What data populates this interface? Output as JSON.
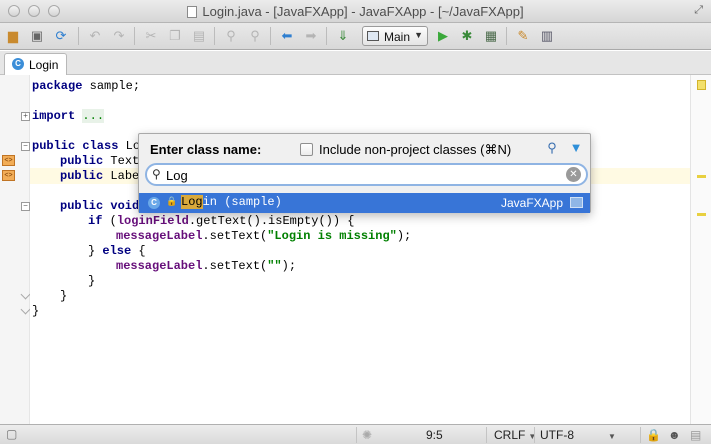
{
  "window": {
    "title": "Login.java - [JavaFXApp] - JavaFXApp - [~/JavaFXApp]"
  },
  "toolbar": {
    "run_config": "Main"
  },
  "tabs": [
    {
      "label": "Login",
      "badge": "C"
    }
  ],
  "code": {
    "l1": {
      "kw": "package",
      "rest": " sample;"
    },
    "l3": {
      "kw": "import",
      "fold": "..."
    },
    "l5": {
      "kw": "public class",
      "rest": " Lo"
    },
    "l6": {
      "kw": "public",
      "rest": " Text"
    },
    "l7": {
      "kw": "public",
      "rest": " Labe"
    },
    "l9": {
      "kw": "public void"
    },
    "l10": {
      "kw": "if",
      "a": " (",
      "fld": "loginField",
      "b": ".getText().isEmpty()) {"
    },
    "l11": {
      "fld": "messageLabel",
      "a": ".setText(",
      "str": "\"Login is missing\"",
      "b": ");"
    },
    "l12": {
      "a": "} ",
      "kw": "else",
      "b": " {"
    },
    "l13": {
      "fld": "messageLabel",
      "a": ".setText(",
      "str": "\"\"",
      "b": ");"
    },
    "l14": "}",
    "l15": "}",
    "l16": "}"
  },
  "popup": {
    "label": "Enter class name:",
    "include_label": "Include non-project classes (⌘N)",
    "include_checked": false,
    "query": "Log",
    "result": {
      "badge": "C",
      "match": "Log",
      "rest": "in (sample)",
      "module": "JavaFXApp"
    }
  },
  "status": {
    "position": "9:5",
    "line_sep": "CRLF",
    "encoding": "UTF-8"
  },
  "colors": {
    "selection": "#3875d7",
    "keyword": "#000080",
    "string": "#008000",
    "field": "#660e7a"
  }
}
